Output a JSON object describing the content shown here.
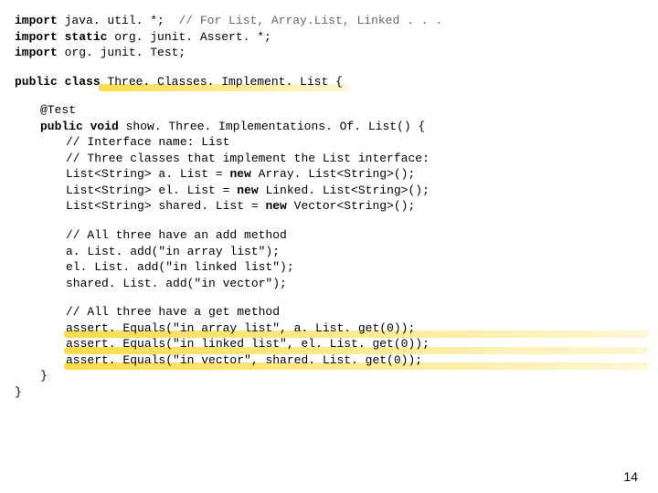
{
  "imports": {
    "l1a": "import",
    "l1b": " java. util. *;  ",
    "l1c": "// For List, Array.List, Linked . . .",
    "l2a": "import",
    "l2b": " static",
    "l2c": " org. junit. Assert. *;",
    "l3a": "import",
    "l3b": " org. junit. Test;"
  },
  "classdecl": {
    "a": "public",
    "b": " class",
    "c": " Three. Classes. Implement. List {"
  },
  "ann": "@Test",
  "method": {
    "a": "public",
    "b": " void",
    "c": " show. Three. Implementations. Of. List() {"
  },
  "body": {
    "c1": "// Interface name: List",
    "c2": "// Three classes that implement the List interface:",
    "d1a": "List<String> a. List = ",
    "d1b": "new",
    "d1c": " Array. List<String>();",
    "d2a": "List<String> el. List = ",
    "d2b": "new",
    "d2c": " Linked. List<String>();",
    "d3a": "List<String> shared. List = ",
    "d3b": "new",
    "d3c": " Vector<String>();",
    "c3": "// All three have an add method",
    "a1": "a. List. add(\"in array list\");",
    "a2": "el. List. add(\"in linked list\");",
    "a3": "shared. List. add(\"in vector\");",
    "c4": "// All three have a get method",
    "g1": "assert. Equals(\"in array list\", a. List. get(0));",
    "g2": "assert. Equals(\"in linked list\", el. List. get(0));",
    "g3": "assert. Equals(\"in vector\", shared. List. get(0));"
  },
  "close1": "}",
  "close2": "}",
  "pagenum": "14"
}
